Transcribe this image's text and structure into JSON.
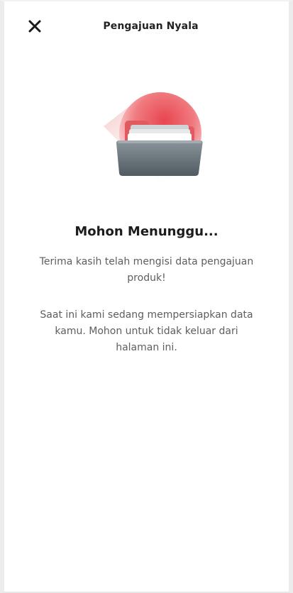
{
  "header": {
    "title": "Pengajuan Nyala",
    "close_icon": "close-icon"
  },
  "illustration": {
    "icon": "folder-icon",
    "accent_color": "#e8454f",
    "folder_color": "#6b767d"
  },
  "content": {
    "heading": "Mohon Menunggu...",
    "paragraph1": "Terima kasih telah mengisi data pengajuan produk!",
    "paragraph2": "Saat ini kami sedang mempersiapkan data kamu. Mohon untuk tidak keluar dari halaman ini."
  }
}
